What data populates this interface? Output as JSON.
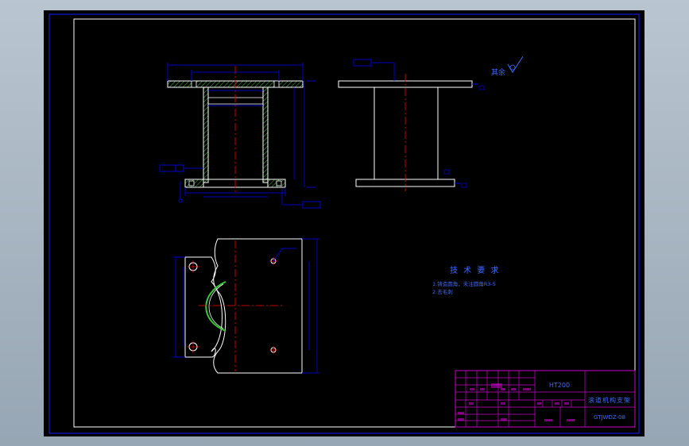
{
  "drawing": {
    "title_block": {
      "material": "HT200",
      "part_name": "滚道机构支架",
      "drawing_number": "GTJWDZ-08"
    },
    "tech_requirements": {
      "heading": "技 术 要 求",
      "items": [
        "1.铸造圆角，未注圆角R3-5",
        "2.去毛刺"
      ]
    },
    "roughness_note": "其余"
  },
  "colors": {
    "background": "#000000",
    "frame": "#1a1aff",
    "outline": "#ffffff",
    "dimension": "#0000ff",
    "centerline": "#ff0000",
    "hatch": "#33cc33",
    "title_grid": "#cc00cc",
    "title_text": "#3b6bff"
  },
  "icons": [
    "roughness-symbol-icon"
  ]
}
